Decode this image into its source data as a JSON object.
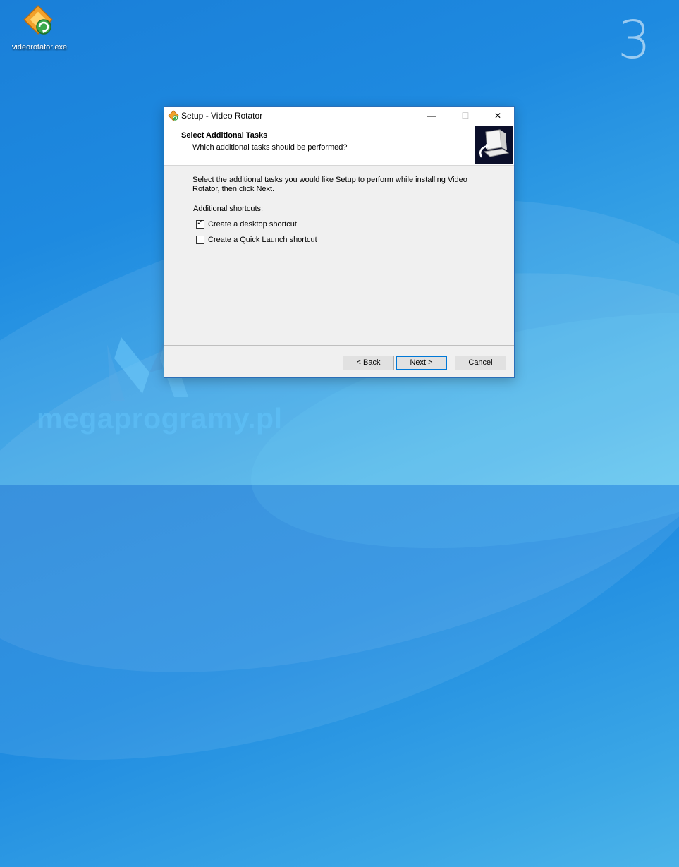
{
  "desktop": {
    "icon_label": "videorotator.exe",
    "slide_number": "3",
    "watermark_text": "megaprogramy.pl"
  },
  "window": {
    "title": "Setup - Video Rotator",
    "controls": {
      "minimize": "—",
      "maximize": "☐",
      "close": "✕"
    },
    "header": {
      "title": "Select Additional Tasks",
      "subtitle": "Which additional tasks should be performed?"
    },
    "body": {
      "instructions": "Select the additional tasks you would like Setup to perform while installing Video Rotator, then click Next.",
      "group_label": "Additional shortcuts:",
      "tasks": [
        {
          "label": "Create a desktop shortcut",
          "checked": true
        },
        {
          "label": "Create a Quick Launch shortcut",
          "checked": false
        }
      ]
    },
    "buttons": {
      "back": "< Back",
      "next": "Next >",
      "cancel": "Cancel"
    }
  },
  "colors": {
    "accent": "#0078d7",
    "desktop_blue": "#1e8ae0",
    "window_bg": "#f0f0f0"
  }
}
